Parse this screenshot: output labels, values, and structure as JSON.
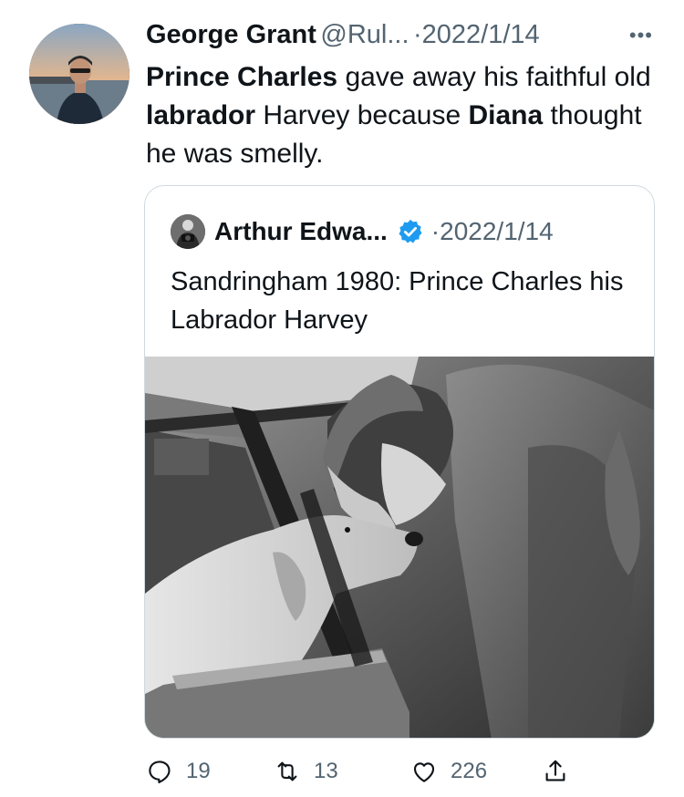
{
  "tweet": {
    "author_name": "George Grant",
    "handle": "@Rul...",
    "separator": "·",
    "date": "2022/1/14",
    "more_icon": "more-horizontal-icon",
    "text_parts": [
      {
        "text": "Prince Charles",
        "bold": true
      },
      {
        "text": " gave away his faithful old ",
        "bold": false
      },
      {
        "text": "labrador",
        "bold": true
      },
      {
        "text": " Harvey because ",
        "bold": false
      },
      {
        "text": "Diana",
        "bold": true
      },
      {
        "text": " thought he was smelly.",
        "bold": false
      }
    ]
  },
  "quoted": {
    "author_name": "Arthur Edwa...",
    "verified_icon": "verified-badge-icon",
    "separator": "·",
    "date": "2022/1/14",
    "text": "Sandringham 1980: Prince Charles his Labrador Harvey",
    "photo_icon": "black-and-white-photo"
  },
  "actions": {
    "reply": {
      "icon": "reply-icon",
      "count": "19"
    },
    "retweet": {
      "icon": "retweet-icon",
      "count": "13"
    },
    "like": {
      "icon": "heart-icon",
      "count": "226"
    },
    "share": {
      "icon": "share-icon"
    }
  },
  "colors": {
    "text": "#0f1419",
    "muted": "#536471",
    "border": "#cfd9de",
    "verified": "#1d9bf0"
  }
}
